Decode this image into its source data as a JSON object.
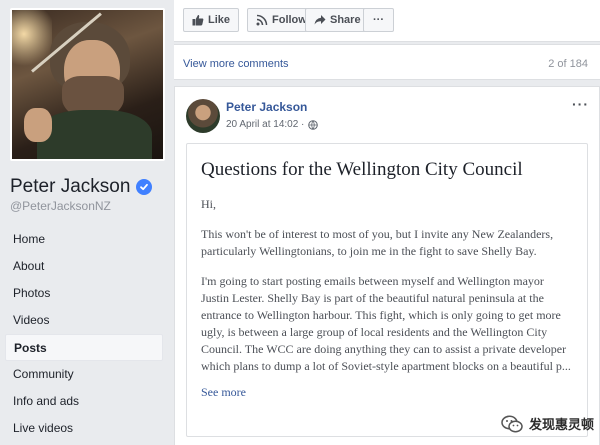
{
  "profile": {
    "name": "Peter Jackson",
    "handle": "@PeterJacksonNZ"
  },
  "sidebar": {
    "items": [
      {
        "label": "Home"
      },
      {
        "label": "About"
      },
      {
        "label": "Photos"
      },
      {
        "label": "Videos"
      },
      {
        "label": "Posts",
        "active": true
      },
      {
        "label": "Community"
      },
      {
        "label": "Info and ads"
      },
      {
        "label": "Live videos"
      }
    ]
  },
  "actions": {
    "like": "Like",
    "follow": "Follow",
    "share": "Share",
    "more": "···"
  },
  "comments": {
    "view_more": "View more comments",
    "counter": "2 of 184"
  },
  "post": {
    "author": "Peter Jackson",
    "timestamp": "20 April at 14:02 ·",
    "more": "···",
    "note": {
      "title": "Questions for the Wellington City Council",
      "greeting": "Hi,",
      "para1": "This won't be of interest to most of you, but I invite any New Zealanders, particularly Wellingtonians, to join me in the fight to save Shelly Bay.",
      "para2": "I'm going to start posting emails between myself and Wellington mayor Justin Lester. Shelly Bay is part of the beautiful natural peninsula at the entrance to Wellington harbour. This fight, which is only going to get more ugly, is between a large group of local residents and the Wellington City Council. The WCC are doing anything they can to assist a private developer which plans to dump a lot of Soviet-style apartment blocks on a beautiful p...",
      "see_more": "See more"
    }
  },
  "watermark": {
    "text": "发现惠灵顿"
  },
  "colors": {
    "link": "#365899",
    "verified": "#4080ff",
    "background": "#e9ebee"
  }
}
